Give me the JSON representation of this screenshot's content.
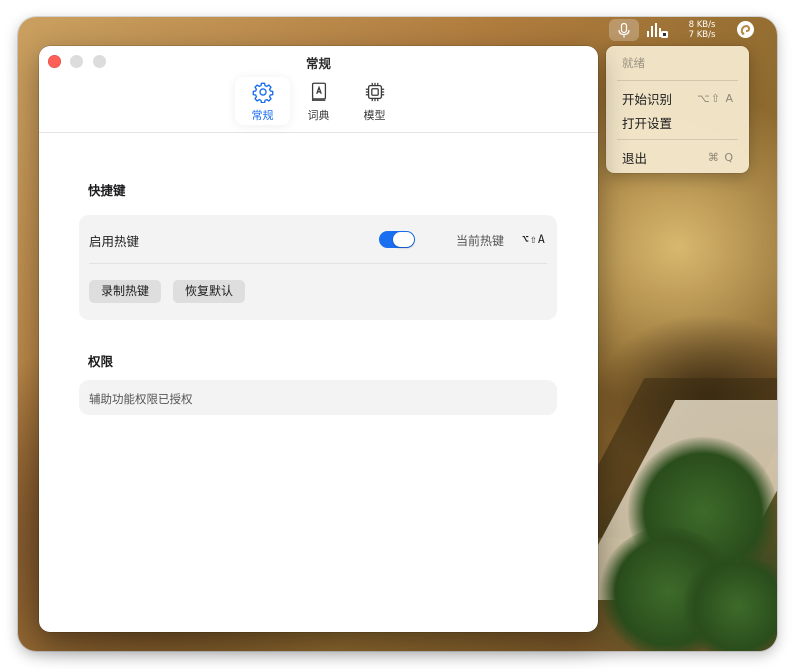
{
  "menubar": {
    "net_up": "8 KB/s",
    "net_down": "7 KB/s",
    "icons": [
      "microphone-icon",
      "audio-level-icon",
      "app-logo-icon"
    ]
  },
  "menu": {
    "status": "就绪",
    "items": [
      {
        "label": "开始识别",
        "shortcut": "⌥⇧ A"
      },
      {
        "label": "打开设置",
        "shortcut": ""
      },
      {
        "label": "退出",
        "shortcut": "⌘ Q"
      }
    ]
  },
  "window": {
    "title": "常规",
    "tabs": [
      {
        "label": "常规",
        "icon": "gear-icon",
        "active": true
      },
      {
        "label": "词典",
        "icon": "dictionary-icon",
        "active": false
      },
      {
        "label": "模型",
        "icon": "chip-icon",
        "active": false
      }
    ]
  },
  "shortcuts": {
    "title": "快捷键",
    "enable_label": "启用热键",
    "enabled": true,
    "current_label": "当前热键",
    "current_value": "⌥⇧A",
    "record_button": "录制热键",
    "reset_button": "恢复默认"
  },
  "permissions": {
    "title": "权限",
    "accessibility_status": "辅助功能权限已授权"
  },
  "colors": {
    "accent": "#1a6ef0",
    "close": "#ff5f57",
    "menu_bg": "#f4e7cb"
  }
}
